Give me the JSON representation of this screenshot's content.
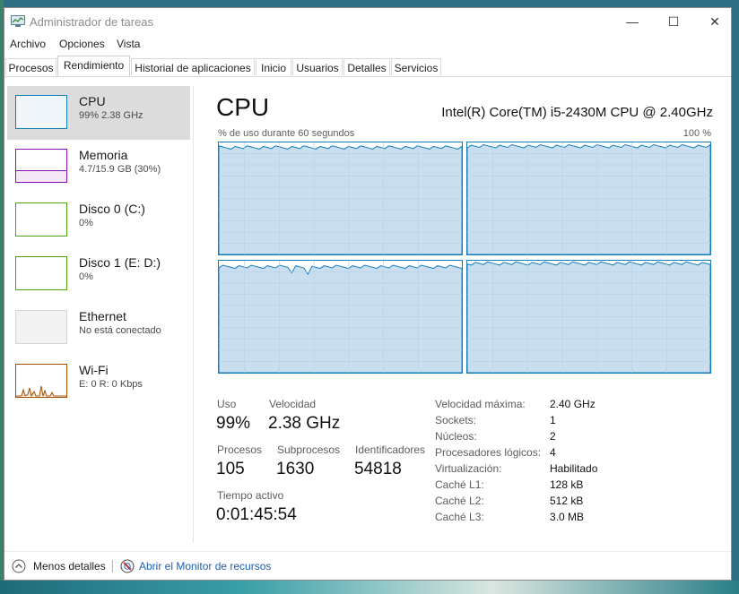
{
  "window": {
    "title": "Administrador de tareas",
    "controls": {
      "minimize": "—",
      "maximize": "☐",
      "close": "✕"
    }
  },
  "menu": {
    "items": [
      "Archivo",
      "Opciones",
      "Vista"
    ]
  },
  "tabs": [
    "Procesos",
    "Rendimiento",
    "Historial de aplicaciones",
    "Inicio",
    "Usuarios",
    "Detalles",
    "Servicios"
  ],
  "active_tab": "Rendimiento",
  "sidebar": {
    "items": [
      {
        "name": "CPU",
        "sub": "99% 2.38 GHz",
        "color": "#117dbb"
      },
      {
        "name": "Memoria",
        "sub": "4.7/15.9 GB (30%)",
        "color": "#8b12ae"
      },
      {
        "name": "Disco 0 (C:)",
        "sub": "0%",
        "color": "#4da60c"
      },
      {
        "name": "Disco 1 (E: D:)",
        "sub": "0%",
        "color": "#4da60c"
      },
      {
        "name": "Ethernet",
        "sub": "No está conectado",
        "color": "#a74f01"
      },
      {
        "name": "Wi-Fi",
        "sub": "E: 0 R: 0 Kbps",
        "color": "#a74f01"
      }
    ]
  },
  "cpu": {
    "title": "CPU",
    "model": "Intel(R) Core(TM) i5-2430M CPU @ 2.40GHz",
    "graph_caption": "% de uso durante 60 segundos",
    "graph_max": "100 %",
    "graph_utilization": [
      0.97,
      0.98,
      0.96,
      0.99
    ]
  },
  "stats": {
    "uso_label": "Uso",
    "uso_value": "99%",
    "velocidad_label": "Velocidad",
    "velocidad_value": "2.38 GHz",
    "procesos_label": "Procesos",
    "procesos_value": "105",
    "subprocesos_label": "Subprocesos",
    "subprocesos_value": "1630",
    "identificadores_label": "Identificadores",
    "identificadores_value": "54818",
    "tiempo_label": "Tiempo activo",
    "tiempo_value": "0:01:45:54"
  },
  "specs": [
    {
      "label": "Velocidad máxima:",
      "value": "2.40 GHz"
    },
    {
      "label": "Sockets:",
      "value": "1"
    },
    {
      "label": "Núcleos:",
      "value": "2"
    },
    {
      "label": "Procesadores lógicos:",
      "value": "4"
    },
    {
      "label": "Virtualización:",
      "value": "Habilitado"
    },
    {
      "label": "Caché L1:",
      "value": "128 kB"
    },
    {
      "label": "Caché L2:",
      "value": "512 kB"
    },
    {
      "label": "Caché L3:",
      "value": "3.0 MB"
    }
  ],
  "footer": {
    "less_details": "Menos detalles",
    "open_monitor": "Abrir el Monitor de recursos"
  }
}
